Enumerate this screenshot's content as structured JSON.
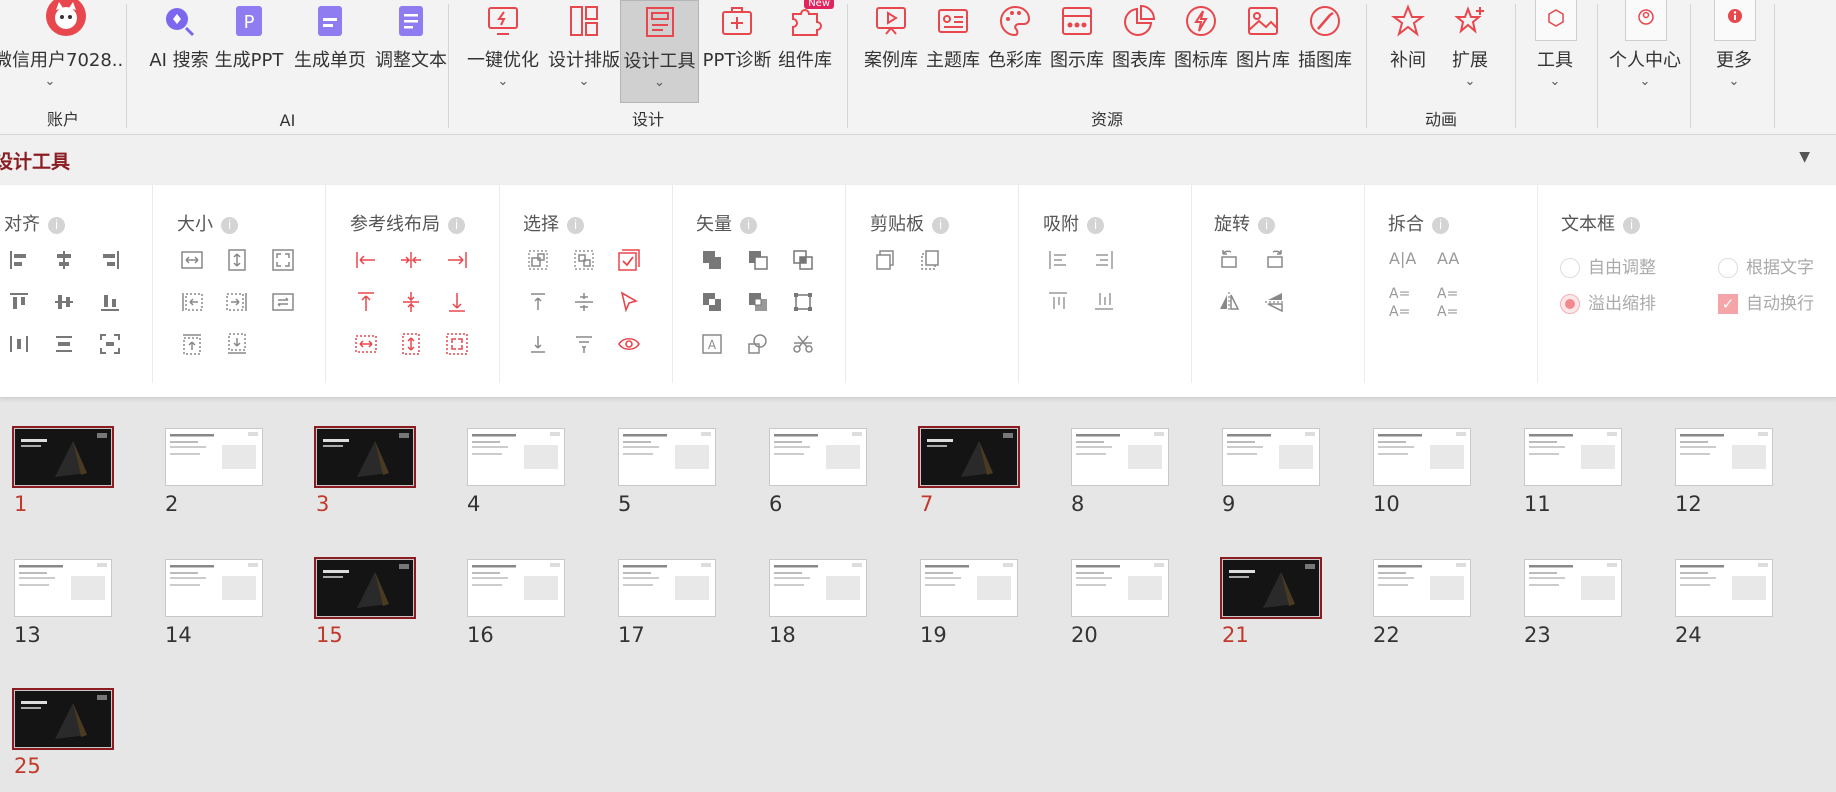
{
  "ribbon": {
    "groups": [
      {
        "label": "账户"
      },
      {
        "label": "AI"
      },
      {
        "label": "设计"
      },
      {
        "label": "资源"
      },
      {
        "label": "动画"
      }
    ],
    "account": {
      "label": "微信用户7028.."
    },
    "buttons": [
      {
        "label": "AI 搜索"
      },
      {
        "label": "生成PPT"
      },
      {
        "label": "生成单页"
      },
      {
        "label": "调整文本"
      },
      {
        "label": "一键优化"
      },
      {
        "label": "设计排版"
      },
      {
        "label": "设计工具"
      },
      {
        "label": "PPT诊断"
      },
      {
        "label": "组件库",
        "badge": "New"
      },
      {
        "label": "案例库"
      },
      {
        "label": "主题库"
      },
      {
        "label": "色彩库"
      },
      {
        "label": "图示库"
      },
      {
        "label": "图表库"
      },
      {
        "label": "图标库"
      },
      {
        "label": "图片库"
      },
      {
        "label": "插图库"
      },
      {
        "label": "补间"
      },
      {
        "label": "扩展"
      },
      {
        "label": "工具"
      },
      {
        "label": "个人中心"
      },
      {
        "label": "更多"
      }
    ],
    "chevron": "⌄",
    "accent_color": "#e8474d"
  },
  "panel": {
    "title": "设计工具",
    "collapse_glyph": "▼",
    "sections": [
      {
        "title": "对齐"
      },
      {
        "title": "大小"
      },
      {
        "title": "参考线布局"
      },
      {
        "title": "选择"
      },
      {
        "title": "矢量"
      },
      {
        "title": "剪贴板"
      },
      {
        "title": "吸附"
      },
      {
        "title": "旋转"
      },
      {
        "title": "拆合"
      },
      {
        "title": "文本框"
      }
    ],
    "info_glyph": "i",
    "textbox_options": [
      {
        "label": "自由调整",
        "checked": false
      },
      {
        "label": "根据文字",
        "checked": false
      },
      {
        "label": "溢出缩排",
        "checked": true
      },
      {
        "label": "自动换行",
        "checked": true
      }
    ],
    "split_labels": [
      "A|A",
      "AA",
      "A=\nA=",
      "A=\nA="
    ]
  },
  "slides": {
    "selection_color": "#8b1d22",
    "number_color_selected": "#c0392b",
    "items": [
      {
        "num": "1",
        "selected": true,
        "dark": true
      },
      {
        "num": "2",
        "selected": false,
        "dark": false
      },
      {
        "num": "3",
        "selected": true,
        "dark": true
      },
      {
        "num": "4",
        "selected": false,
        "dark": false
      },
      {
        "num": "5",
        "selected": false,
        "dark": false
      },
      {
        "num": "6",
        "selected": false,
        "dark": false
      },
      {
        "num": "7",
        "selected": true,
        "dark": true
      },
      {
        "num": "8",
        "selected": false,
        "dark": false
      },
      {
        "num": "9",
        "selected": false,
        "dark": false
      },
      {
        "num": "10",
        "selected": false,
        "dark": false
      },
      {
        "num": "11",
        "selected": false,
        "dark": false
      },
      {
        "num": "12",
        "selected": false,
        "dark": false
      },
      {
        "num": "13",
        "selected": false,
        "dark": false
      },
      {
        "num": "14",
        "selected": false,
        "dark": false
      },
      {
        "num": "15",
        "selected": true,
        "dark": true
      },
      {
        "num": "16",
        "selected": false,
        "dark": false
      },
      {
        "num": "17",
        "selected": false,
        "dark": false
      },
      {
        "num": "18",
        "selected": false,
        "dark": false
      },
      {
        "num": "19",
        "selected": false,
        "dark": false
      },
      {
        "num": "20",
        "selected": false,
        "dark": false
      },
      {
        "num": "21",
        "selected": true,
        "dark": true
      },
      {
        "num": "22",
        "selected": false,
        "dark": false
      },
      {
        "num": "23",
        "selected": false,
        "dark": false
      },
      {
        "num": "24",
        "selected": false,
        "dark": false
      },
      {
        "num": "25",
        "selected": true,
        "dark": true
      }
    ]
  }
}
